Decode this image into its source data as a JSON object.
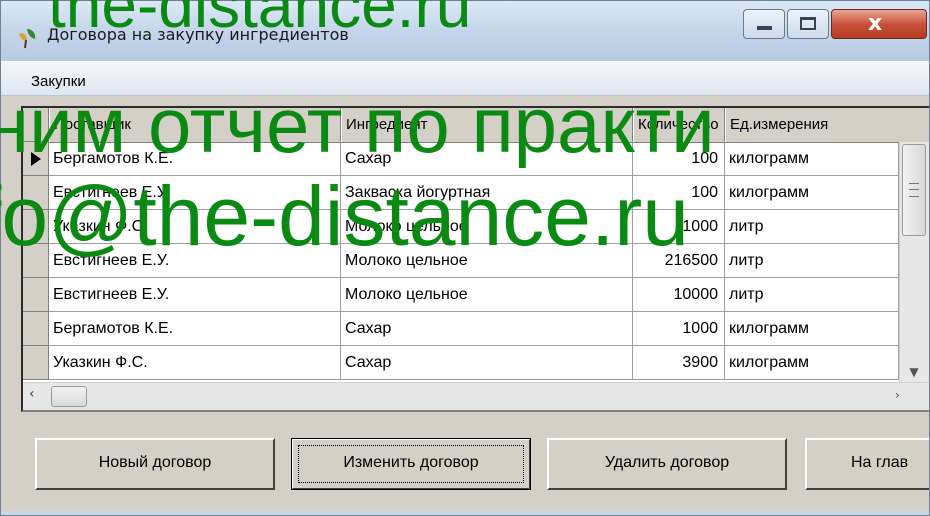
{
  "window": {
    "title": "Договора на закупку ингредиентов",
    "controls": [
      "minimize",
      "maximize",
      "close"
    ],
    "close_glyph": "x"
  },
  "menu": {
    "items": [
      "Закупки"
    ]
  },
  "grid": {
    "columns": [
      "Поставщик",
      "Ингредиент",
      "Количество",
      "Ед.измерения"
    ],
    "selected_row": 0,
    "rows": [
      {
        "supplier": "Бергамотов К.Е.",
        "ingredient": "Сахар",
        "quantity": "100",
        "unit": "килограмм"
      },
      {
        "supplier": "Евстигнеев Е.У.",
        "ingredient": "Закваска йогуртная",
        "quantity": "100",
        "unit": "килограмм"
      },
      {
        "supplier": "Указкин Ф.С.",
        "ingredient": "Молоко цельное",
        "quantity": "1000",
        "unit": "литр"
      },
      {
        "supplier": "Евстигнеев Е.У.",
        "ingredient": "Молоко цельное",
        "quantity": "216500",
        "unit": "литр"
      },
      {
        "supplier": "Евстигнеев Е.У.",
        "ingredient": "Молоко цельное",
        "quantity": "10000",
        "unit": "литр"
      },
      {
        "supplier": "Бергамотов К.Е.",
        "ingredient": "Сахар",
        "quantity": "1000",
        "unit": "килограмм"
      },
      {
        "supplier": "Указкин Ф.С.",
        "ingredient": "Сахар",
        "quantity": "3900",
        "unit": "килограмм"
      }
    ]
  },
  "buttons": {
    "new_contract": "Новый договор",
    "edit_contract": "Изменить договор",
    "delete_contract": "Удалить договор",
    "to_main": "На глав"
  },
  "watermark": {
    "line1": "the-distance.ru",
    "line2": "ним отчет по практи",
    "line3": "fo@the-distance.ru",
    "color": "#0a8a12"
  },
  "icons": {
    "app": "leaf-app-icon",
    "row_pointer": "triangle-right-icon",
    "scroll_up": "arrow-up-icon",
    "scroll_down": "arrow-down-icon",
    "scroll_left": "arrow-left-icon",
    "scroll_right": "arrow-right-icon"
  }
}
